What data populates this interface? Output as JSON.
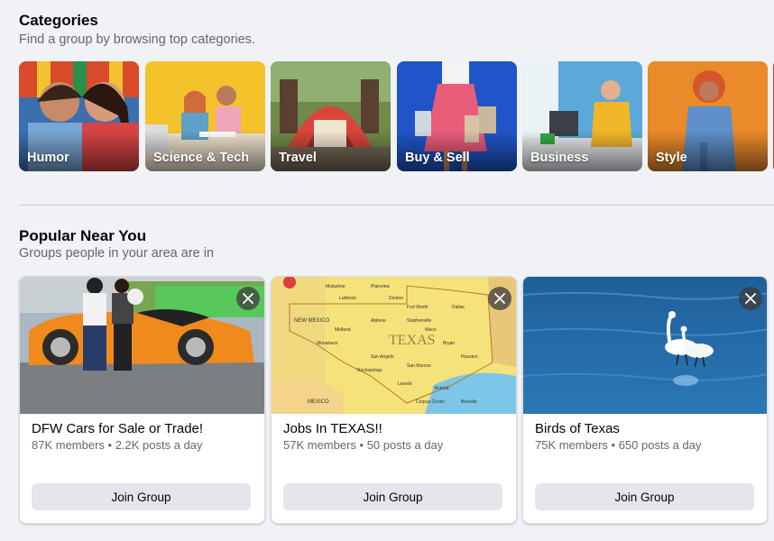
{
  "categories": {
    "title": "Categories",
    "subtitle": "Find a group by browsing top categories.",
    "items": [
      {
        "label": "Humor"
      },
      {
        "label": "Science & Tech"
      },
      {
        "label": "Travel"
      },
      {
        "label": "Buy & Sell"
      },
      {
        "label": "Business"
      },
      {
        "label": "Style"
      }
    ]
  },
  "popular": {
    "title": "Popular Near You",
    "subtitle": "Groups people in your area are in",
    "groups": [
      {
        "name": "DFW Cars for Sale or Trade!",
        "meta": "87K members • 2.2K posts a day",
        "join": "Join Group",
        "image_icon": "orange-sports-car"
      },
      {
        "name": "Jobs In TEXAS!!",
        "meta": "57K members • 50 posts a day",
        "join": "Join Group",
        "image_icon": "texas-map"
      },
      {
        "name": "Birds of Texas",
        "meta": "75K members • 650 posts a day",
        "join": "Join Group",
        "image_icon": "white-egrets-water"
      }
    ]
  },
  "map": {
    "state_label": "TEXAS",
    "mexico_label": "MEXICO",
    "new_mexico_label": "NEW MEXICO"
  }
}
